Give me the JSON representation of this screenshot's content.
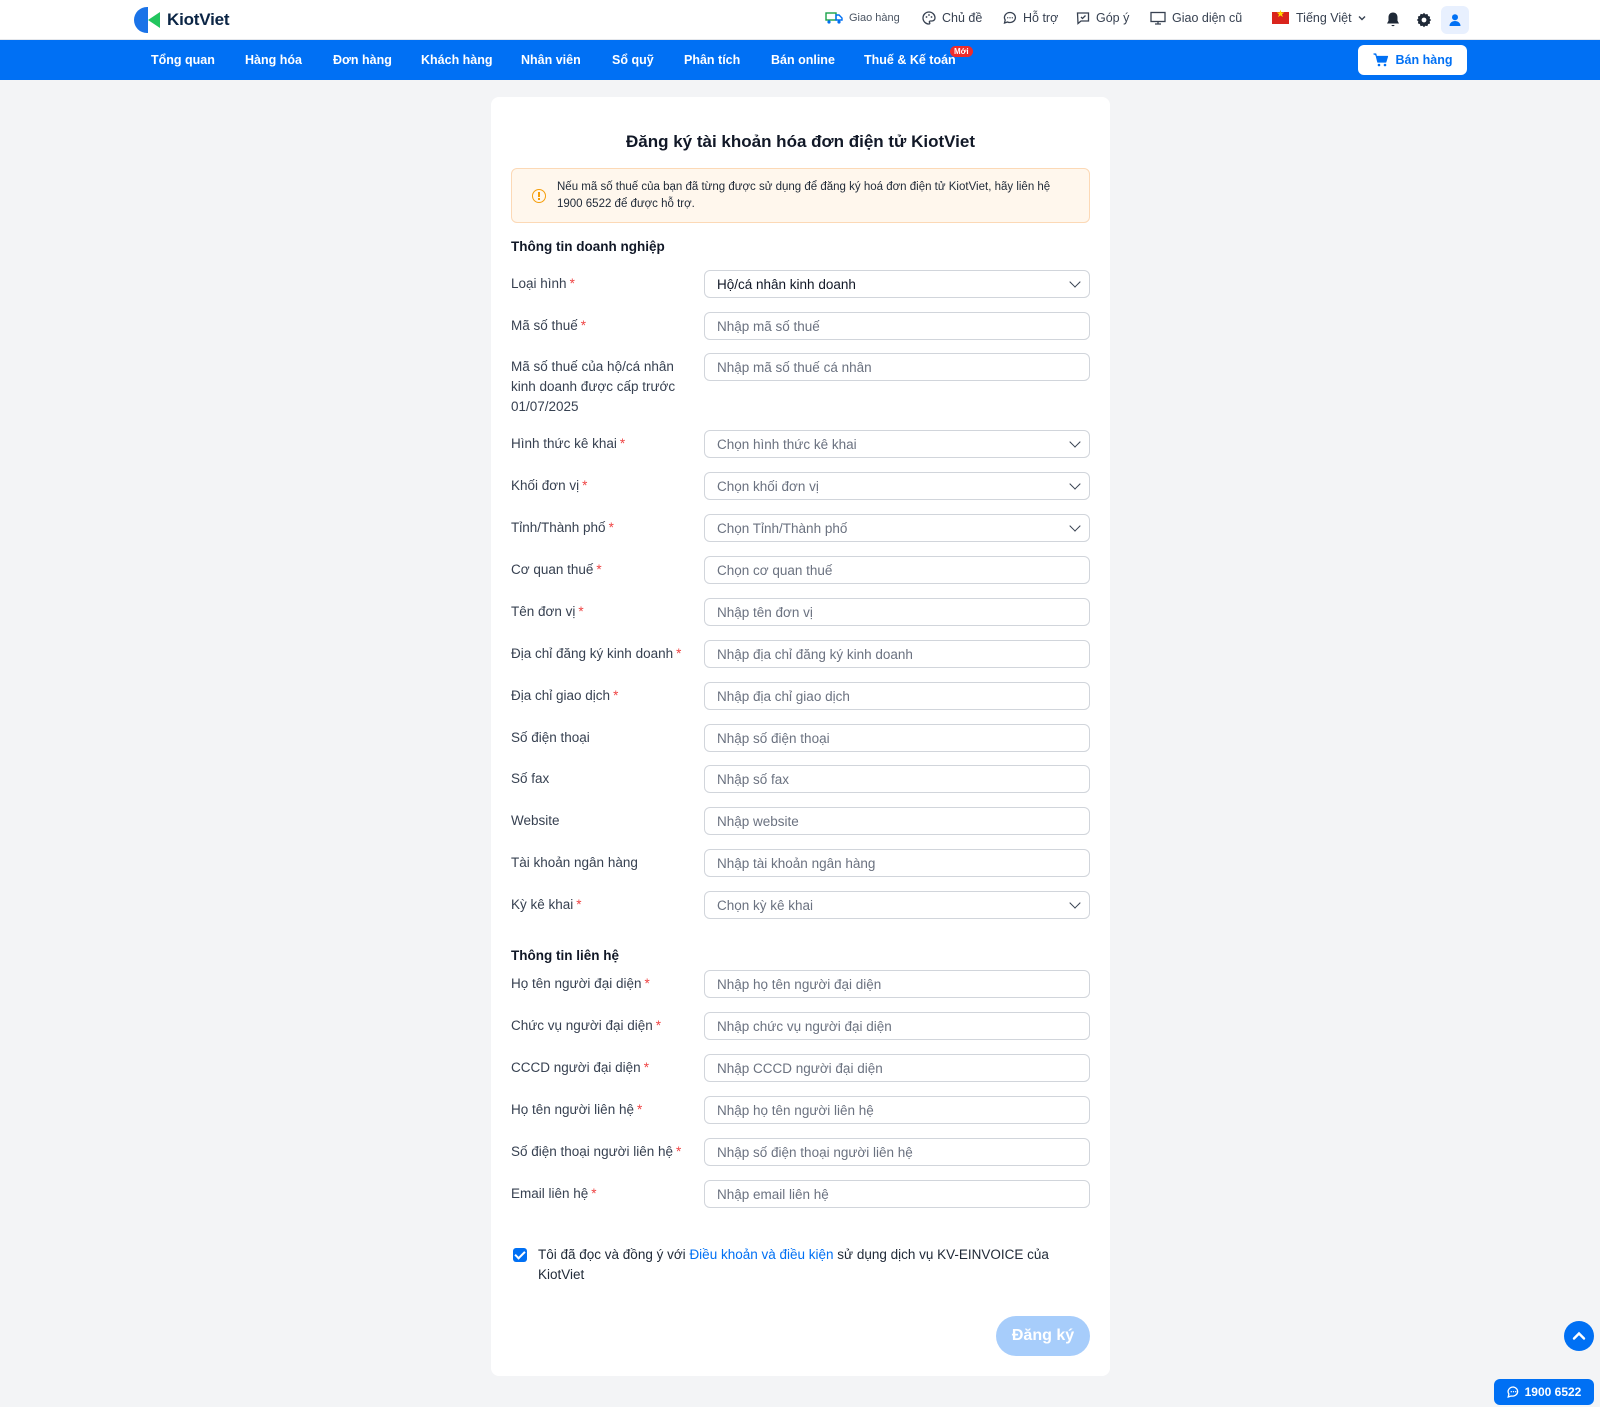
{
  "app": {
    "logo_text": "KiotViet"
  },
  "topbar": {
    "delivery": "Giao hàng",
    "theme": "Chủ đề",
    "support": "Hỗ trợ",
    "feedback": "Góp ý",
    "old_ui": "Giao diện cũ",
    "language": "Tiếng Việt"
  },
  "nav": {
    "items": [
      "Tổng quan",
      "Hàng hóa",
      "Đơn hàng",
      "Khách hàng",
      "Nhân viên",
      "Sổ quỹ",
      "Phân tích",
      "Bán online",
      "Thuế & Kế toán"
    ],
    "new_badge": "Mới",
    "sell_button": "Bán hàng"
  },
  "form": {
    "title": "Đăng ký tài khoản hóa đơn điện tử KiotViet",
    "notice": "Nếu mã số thuế của bạn đã từng được sử dụng để đăng ký hoá đơn điện tử KiotViet, hãy liên hệ 1900 6522 để được hỗ trợ.",
    "section_business": "Thông tin doanh nghiệp",
    "section_contact": "Thông tin liên hệ",
    "business_fields": [
      {
        "label": "Loại hình",
        "required": true,
        "value": "Hộ/cá nhân kinh doanh",
        "type": "select"
      },
      {
        "label": "Mã số thuế",
        "required": true,
        "placeholder": "Nhập mã số thuế",
        "type": "input"
      },
      {
        "label": "Mã số thuế của hộ/cá nhân kinh doanh được cấp trước 01/07/2025",
        "required": false,
        "placeholder": "Nhập mã số thuế cá nhân",
        "type": "input"
      },
      {
        "label": "Hình thức kê khai",
        "required": true,
        "placeholder": "Chọn hình thức kê khai",
        "type": "select"
      },
      {
        "label": "Khối đơn vị",
        "required": true,
        "placeholder": "Chọn khối đơn vị",
        "type": "select"
      },
      {
        "label": "Tỉnh/Thành phố",
        "required": true,
        "placeholder": "Chọn Tỉnh/Thành phố",
        "type": "select"
      },
      {
        "label": "Cơ quan thuế",
        "required": true,
        "placeholder": "Chọn cơ quan thuế",
        "type": "input"
      },
      {
        "label": "Tên đơn vị",
        "required": true,
        "placeholder": "Nhập tên đơn vị",
        "type": "input"
      },
      {
        "label": "Địa chỉ đăng ký kinh doanh",
        "required": true,
        "placeholder": "Nhập địa chỉ đăng ký kinh doanh",
        "type": "input"
      },
      {
        "label": "Địa chỉ giao dịch",
        "required": true,
        "placeholder": "Nhập địa chỉ giao dịch",
        "type": "input"
      },
      {
        "label": "Số điện thoại",
        "required": false,
        "placeholder": "Nhập số điện thoại",
        "type": "input"
      },
      {
        "label": "Số fax",
        "required": false,
        "placeholder": "Nhập số fax",
        "type": "input"
      },
      {
        "label": "Website",
        "required": false,
        "placeholder": "Nhập website",
        "type": "input"
      },
      {
        "label": "Tài khoản ngân hàng",
        "required": false,
        "placeholder": "Nhập tài khoản ngân hàng",
        "type": "input"
      },
      {
        "label": "Kỳ kê khai",
        "required": true,
        "placeholder": "Chọn kỳ kê khai",
        "type": "select"
      }
    ],
    "contact_fields": [
      {
        "label": "Họ tên người đại diện",
        "required": true,
        "placeholder": "Nhập họ tên người đại diện"
      },
      {
        "label": "Chức vụ người đại diện",
        "required": true,
        "placeholder": "Nhập chức vụ người đại diện"
      },
      {
        "label": "CCCD người đại diện",
        "required": true,
        "placeholder": "Nhập CCCD người đại diện"
      },
      {
        "label": "Họ tên người liên hệ",
        "required": true,
        "placeholder": "Nhập họ tên người liên hệ"
      },
      {
        "label": "Số điện thoại người liên hệ",
        "required": true,
        "placeholder": "Nhập số điện thoại người liên hệ"
      },
      {
        "label": "Email liên hệ",
        "required": true,
        "placeholder": "Nhập email liên hệ"
      }
    ],
    "agree_prefix": "Tôi đã đọc và đồng ý với ",
    "agree_link": "Điều khoản và điều kiện",
    "agree_suffix": " sử dụng dịch vụ KV-EINVOICE của KiotViet",
    "agree_checked": true,
    "submit": "Đăng ký"
  },
  "floating": {
    "hotline": "1900 6522"
  },
  "colors": {
    "primary": "#0070f4",
    "required": "#ef4444",
    "notice_bg": "#fff7ed",
    "submit_disabled": "#a7cdfb"
  }
}
